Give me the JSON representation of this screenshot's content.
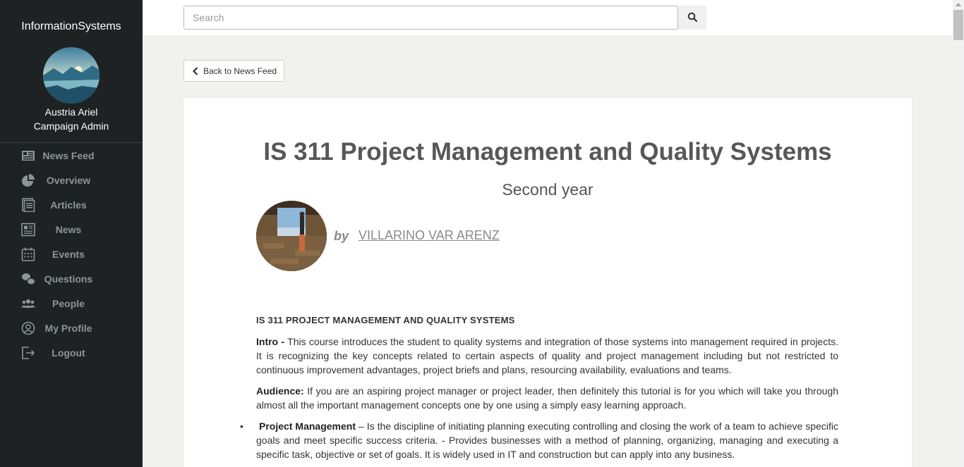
{
  "sidebar": {
    "brand": "InformationSystems",
    "user_name": "Austria Ariel",
    "user_role": "Campaign Admin",
    "items": [
      {
        "label": "News Feed",
        "icon": "news-feed-icon"
      },
      {
        "label": "Overview",
        "icon": "pie-chart-icon"
      },
      {
        "label": "Articles",
        "icon": "articles-icon"
      },
      {
        "label": "News",
        "icon": "newspaper-icon"
      },
      {
        "label": "Events",
        "icon": "calendar-icon"
      },
      {
        "label": "Questions",
        "icon": "chat-bubbles-icon"
      },
      {
        "label": "People",
        "icon": "people-icon"
      },
      {
        "label": "My Profile",
        "icon": "user-circle-icon"
      },
      {
        "label": "Logout",
        "icon": "logout-icon"
      }
    ]
  },
  "search": {
    "placeholder": "Search",
    "icon": "search-icon"
  },
  "back_button": {
    "label": "Back to News Feed",
    "icon": "chevron-left-icon"
  },
  "article": {
    "title": "IS 311 Project Management and Quality Systems",
    "subtitle": "Second year",
    "by": "by",
    "author": "VILLARINO VAR ARENZ",
    "heading": "IS 311 PROJECT MANAGEMENT AND QUALITY SYSTEMS",
    "intro_label": "Intro -",
    "intro_text": " This course introduces the student to quality systems and integration of those systems into management required in projects. It is recognizing the key concepts related to certain aspects of quality and project management including but not restricted to continuous improvement advantages, project briefs and plans, resourcing availability, evaluations and teams.",
    "audience_label": "Audience:",
    "audience_text": "  If you are an aspiring project manager or project leader, then definitely this tutorial is for you which will take you through almost all the important management concepts one by one using a simply easy learning approach.",
    "bullet_label": "Project Management",
    "bullet_text": " – Is the discipline of initiating planning executing controlling and closing the work of a team to achieve specific goals and meet specific success criteria. - Provides businesses with a method of planning, organizing, managing and executing a specific task, objective or set of goals. It is widely used in IT and construction but can apply into any business."
  },
  "colors": {
    "sidebar_bg": "#1e2222",
    "nav_text": "#8f9494",
    "page_bg": "#f1f1ee",
    "title": "#575757"
  }
}
